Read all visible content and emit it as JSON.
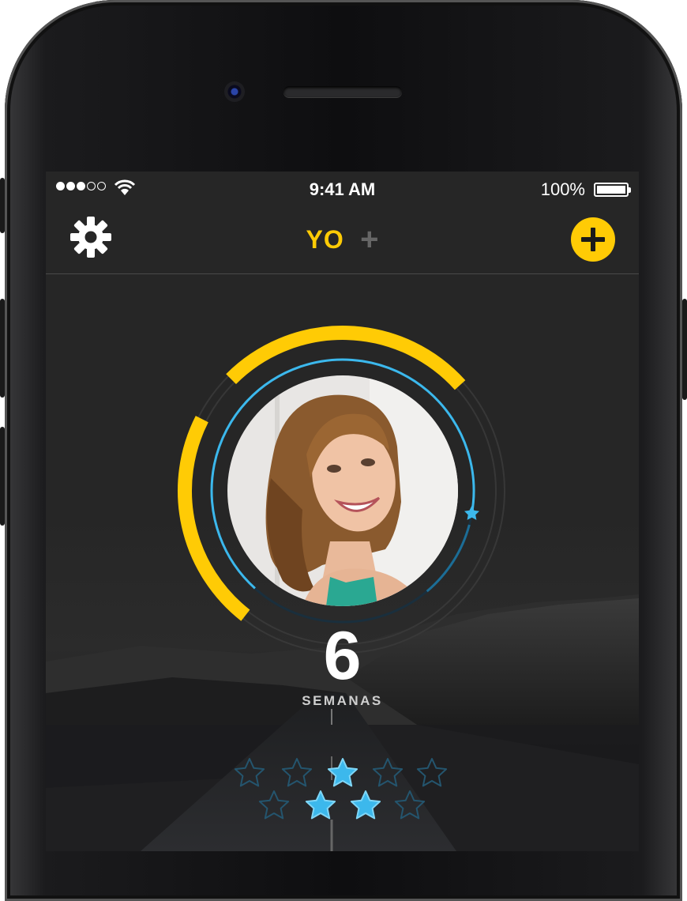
{
  "status_bar": {
    "signal_bars_filled": 3,
    "signal_bars_total": 5,
    "time": "9:41 AM",
    "battery_percent": "100%"
  },
  "nav": {
    "settings_icon": "gear-icon",
    "title": "YO",
    "title_add_symbol": "+",
    "add_icon": "plus-circle-icon"
  },
  "progress": {
    "weeks": "6",
    "weeks_label": "SEMANAS",
    "outer_ring_fraction": 0.62,
    "inner_ring_fraction": 0.78
  },
  "stars": {
    "row1_filled": [
      false,
      false,
      true,
      false,
      false
    ],
    "row2_filled": [
      false,
      true,
      true,
      false
    ]
  },
  "colors": {
    "accent_yellow": "#ffcb05",
    "accent_blue": "#3cb8ec",
    "background": "#262626"
  }
}
